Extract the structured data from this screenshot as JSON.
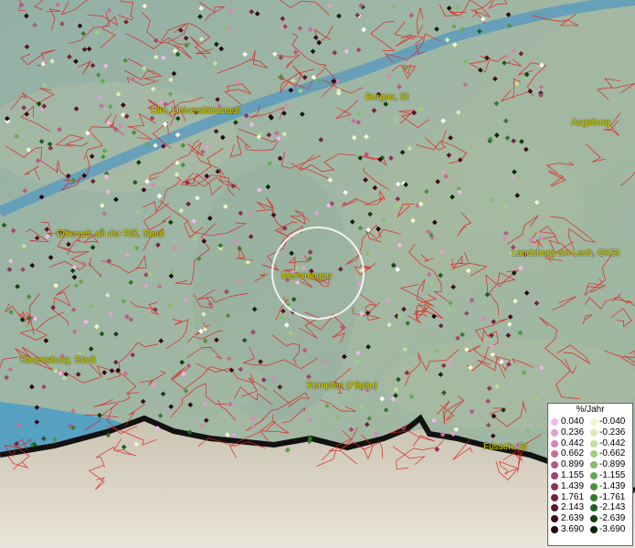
{
  "map": {
    "cities": [
      {
        "label": "Ulm, Universitätsstadt"
      },
      {
        "label": "Burgau, St"
      },
      {
        "label": "Augsburg"
      },
      {
        "label": "Biberach an der Riß, Stadt"
      },
      {
        "label": "Landsberg am Lech, GKSt"
      },
      {
        "label": "Memmingen"
      },
      {
        "label": "Ravensburg, Stadt"
      },
      {
        "label": "Kempten (Allgäu)"
      },
      {
        "label": "Füssen, St"
      }
    ],
    "legend": {
      "title": "%/Jahr",
      "positive": [
        {
          "value": "0.040",
          "color": "#f3b7ee"
        },
        {
          "value": "0.236",
          "color": "#e39fd2"
        },
        {
          "value": "0.442",
          "color": "#d687b8"
        },
        {
          "value": "0.662",
          "color": "#c56f9c"
        },
        {
          "value": "0.899",
          "color": "#b45a84"
        },
        {
          "value": "1.155",
          "color": "#a1456c"
        },
        {
          "value": "1.439",
          "color": "#8a3254"
        },
        {
          "value": "1.761",
          "color": "#72223f"
        },
        {
          "value": "2.143",
          "color": "#58142b"
        },
        {
          "value": "2.639",
          "color": "#3e0a1a"
        },
        {
          "value": "3.690",
          "color": "#22040c"
        }
      ],
      "negative": [
        {
          "value": "-0.040",
          "color": "#f4f7c8"
        },
        {
          "value": "-0.236",
          "color": "#dcedb2"
        },
        {
          "value": "-0.442",
          "color": "#c2e09a"
        },
        {
          "value": "-0.662",
          "color": "#a2cf80"
        },
        {
          "value": "-0.899",
          "color": "#84bd69"
        },
        {
          "value": "-1.155",
          "color": "#66a853"
        },
        {
          "value": "-1.439",
          "color": "#4b913f"
        },
        {
          "value": "-1.761",
          "color": "#33782d"
        },
        {
          "value": "-2.143",
          "color": "#1f5d1d"
        },
        {
          "value": "-2.639",
          "color": "#0f4010"
        },
        {
          "value": "-3.690",
          "color": "#042406"
        }
      ]
    },
    "colors": {
      "boundary": "#e02020",
      "river": "#5d9bbd",
      "coast": "#111111",
      "label": "#d8d800",
      "highlight": "#ffffff",
      "no_data": "#ffffff"
    }
  }
}
